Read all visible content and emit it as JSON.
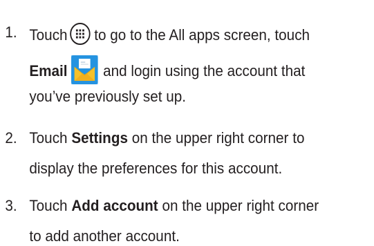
{
  "steps": [
    {
      "number": "1.",
      "lines": [
        {
          "pre": "Touch",
          "post": "to go to the All apps screen, touch"
        },
        {
          "bold": "Email",
          "post": "and login using the account that"
        },
        {
          "text": "you’ve previously set up."
        }
      ],
      "icons": [
        "all-apps-icon",
        "email-app-icon"
      ]
    },
    {
      "number": "2.",
      "lines": [
        {
          "pre": "Touch",
          "bold": "Settings",
          "post": "on the upper right corner to"
        },
        {
          "text": "display the preferences for this account."
        }
      ]
    },
    {
      "number": "3.",
      "lines": [
        {
          "pre": "Touch",
          "bold": "Add account",
          "post": "on the upper right corner"
        },
        {
          "text": "to add another account."
        }
      ]
    }
  ],
  "colors": {
    "text": "#231f20",
    "email_icon_bg": "#1e88d6",
    "email_icon_envelope": "#f7c12a"
  }
}
